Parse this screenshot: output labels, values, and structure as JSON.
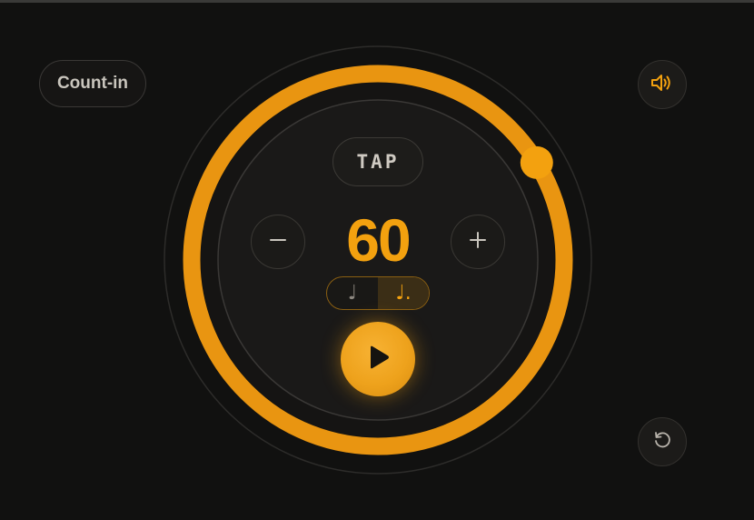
{
  "count_in": {
    "label": "Count-in"
  },
  "tap": {
    "label": "TAP"
  },
  "tempo": {
    "bpm": "60",
    "dial_fraction": 0.25,
    "decrement_icon": "minus-icon",
    "increment_icon": "plus-icon"
  },
  "note_value": {
    "options": [
      "♩",
      "♩."
    ],
    "selected_index": 1
  },
  "controls": {
    "play_icon": "play-icon",
    "volume_icon": "speaker-icon",
    "reset_icon": "reset-icon"
  },
  "colors": {
    "accent": "#f3a10f",
    "background": "#111110",
    "surface": "#1c1b19",
    "text_muted": "#c9c5bd"
  }
}
